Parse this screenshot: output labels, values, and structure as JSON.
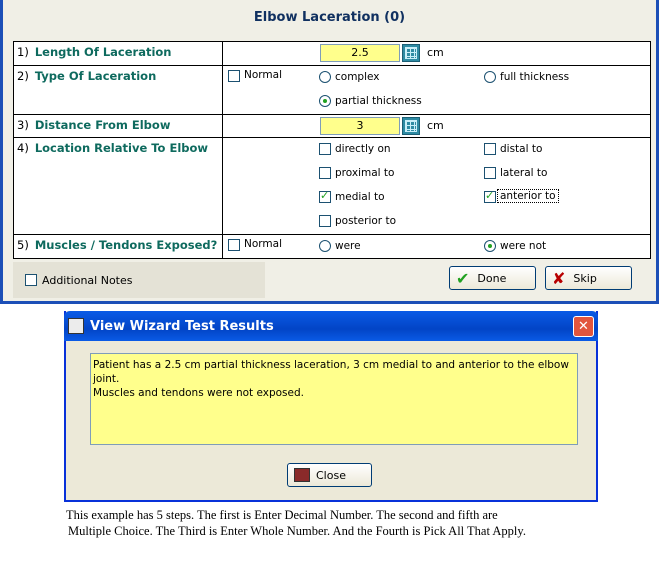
{
  "wizard": {
    "title": "Elbow Laceration (0)",
    "steps": [
      {
        "num": "1)",
        "label": "Length Of Laceration",
        "value": "2.5",
        "unit": "cm"
      },
      {
        "num": "2)",
        "label": "Type Of Laceration",
        "normal_label": "Normal",
        "options": [
          {
            "label": "complex",
            "selected": false
          },
          {
            "label": "full thickness",
            "selected": false
          },
          {
            "label": "partial thickness",
            "selected": true
          }
        ]
      },
      {
        "num": "3)",
        "label": "Distance From Elbow",
        "value": "3",
        "unit": "cm"
      },
      {
        "num": "4)",
        "label": "Location Relative To Elbow",
        "options": [
          {
            "label": "directly on",
            "checked": false
          },
          {
            "label": "distal to",
            "checked": false
          },
          {
            "label": "proximal to",
            "checked": false
          },
          {
            "label": "lateral to",
            "checked": false
          },
          {
            "label": "medial to",
            "checked": true
          },
          {
            "label": "anterior to",
            "checked": true
          },
          {
            "label": "posterior to",
            "checked": false
          }
        ]
      },
      {
        "num": "5)",
        "label": "Muscles / Tendons Exposed?",
        "normal_label": "Normal",
        "options": [
          {
            "label": "were",
            "selected": false
          },
          {
            "label": "were not",
            "selected": true
          }
        ]
      }
    ],
    "additional_notes_label": "Additional Notes",
    "done_label": "Done",
    "skip_label": "Skip"
  },
  "results_dialog": {
    "title": "View Wizard Test Results",
    "text_line1": "Patient has a 2.5 cm partial thickness laceration, 3 cm medial to and anterior to the elbow joint.",
    "text_line2": "Muscles and tendons were not exposed.",
    "close_label": "Close"
  },
  "caption": {
    "line1": "This example has 5 steps.  The first is Enter Decimal Number.  The second and fifth are",
    "line2": "Multiple Choice.  The Third is Enter Whole Number.  And the Fourth is Pick All That Apply."
  },
  "icons": {
    "calculator": "calculator-icon",
    "done": "checkmark-icon",
    "skip": "x-icon",
    "close": "door-exit-icon",
    "app": "app-icon"
  },
  "colors": {
    "input_bg": "#ffff8c",
    "label": "#0e6a5e",
    "title_bar": "#0a5be6",
    "check": "#21a121"
  }
}
